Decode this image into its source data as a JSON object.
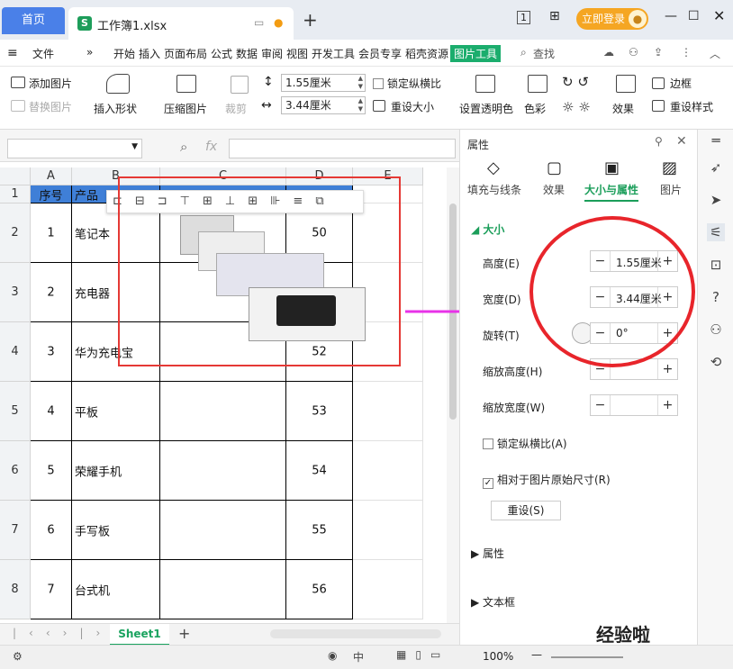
{
  "titlebar": {
    "home_tab": "首页",
    "file_tab": "工作簿1.xlsx",
    "file_icon": "S",
    "login": "立即登录",
    "page_num": "1"
  },
  "menu": {
    "file": "文件",
    "items": [
      "开始",
      "插入",
      "页面布局",
      "公式",
      "数据",
      "审阅",
      "视图",
      "开发工具",
      "会员专享",
      "稻壳资源"
    ],
    "picture_tools": "图片工具",
    "search": "查找"
  },
  "ribbon": {
    "add_picture": "添加图片",
    "replace_picture": "替换图片",
    "insert_shape": "插入形状",
    "compress": "压缩图片",
    "crop": "裁剪",
    "height": "1.55厘米",
    "width": "3.44厘米",
    "lock_ratio": "锁定纵横比",
    "reset_size": "重设大小",
    "set_transparent": "设置透明色",
    "color": "色彩",
    "effects": "效果",
    "border": "边框",
    "reset_style": "重设样式"
  },
  "formula": {
    "fx": "fx"
  },
  "sheet": {
    "columns": [
      "A",
      "B",
      "C",
      "D",
      "E"
    ],
    "rows": [
      "1",
      "2",
      "3",
      "4",
      "5",
      "6",
      "7",
      "8"
    ],
    "header": [
      "序号",
      "产品"
    ],
    "data": [
      {
        "no": "1",
        "product": "笔记本",
        "value": "50"
      },
      {
        "no": "2",
        "product": "充电器",
        "value": ""
      },
      {
        "no": "3",
        "product": "华为充电宝",
        "value": "52"
      },
      {
        "no": "4",
        "product": "平板",
        "value": "53"
      },
      {
        "no": "5",
        "product": "荣耀手机",
        "value": "54"
      },
      {
        "no": "6",
        "product": "手写板",
        "value": "55"
      },
      {
        "no": "7",
        "product": "台式机",
        "value": "56"
      }
    ],
    "tab": "Sheet1"
  },
  "panel": {
    "title": "属性",
    "tabs": [
      "填充与线条",
      "效果",
      "大小与属性",
      "图片"
    ],
    "section": "大小",
    "height_label": "高度(E)",
    "height": "1.55厘米",
    "width_label": "宽度(D)",
    "width": "3.44厘米",
    "rotate_label": "旋转(T)",
    "rotate": "0°",
    "scale_h_label": "缩放高度(H)",
    "scale_w_label": "缩放宽度(W)",
    "lock_ratio": "锁定纵横比(A)",
    "relative": "相对于图片原始尺寸(R)",
    "reset": "重设(S)",
    "attr_section": "属性",
    "textbox_section": "文本框"
  },
  "status": {
    "zoom": "100%"
  },
  "watermark": "经验啦",
  "colors": {
    "accent": "#4a80e8",
    "green": "#1bad6d",
    "red": "#e53935",
    "magenta": "#e832e8",
    "header_fill": "#3f7fd7"
  }
}
